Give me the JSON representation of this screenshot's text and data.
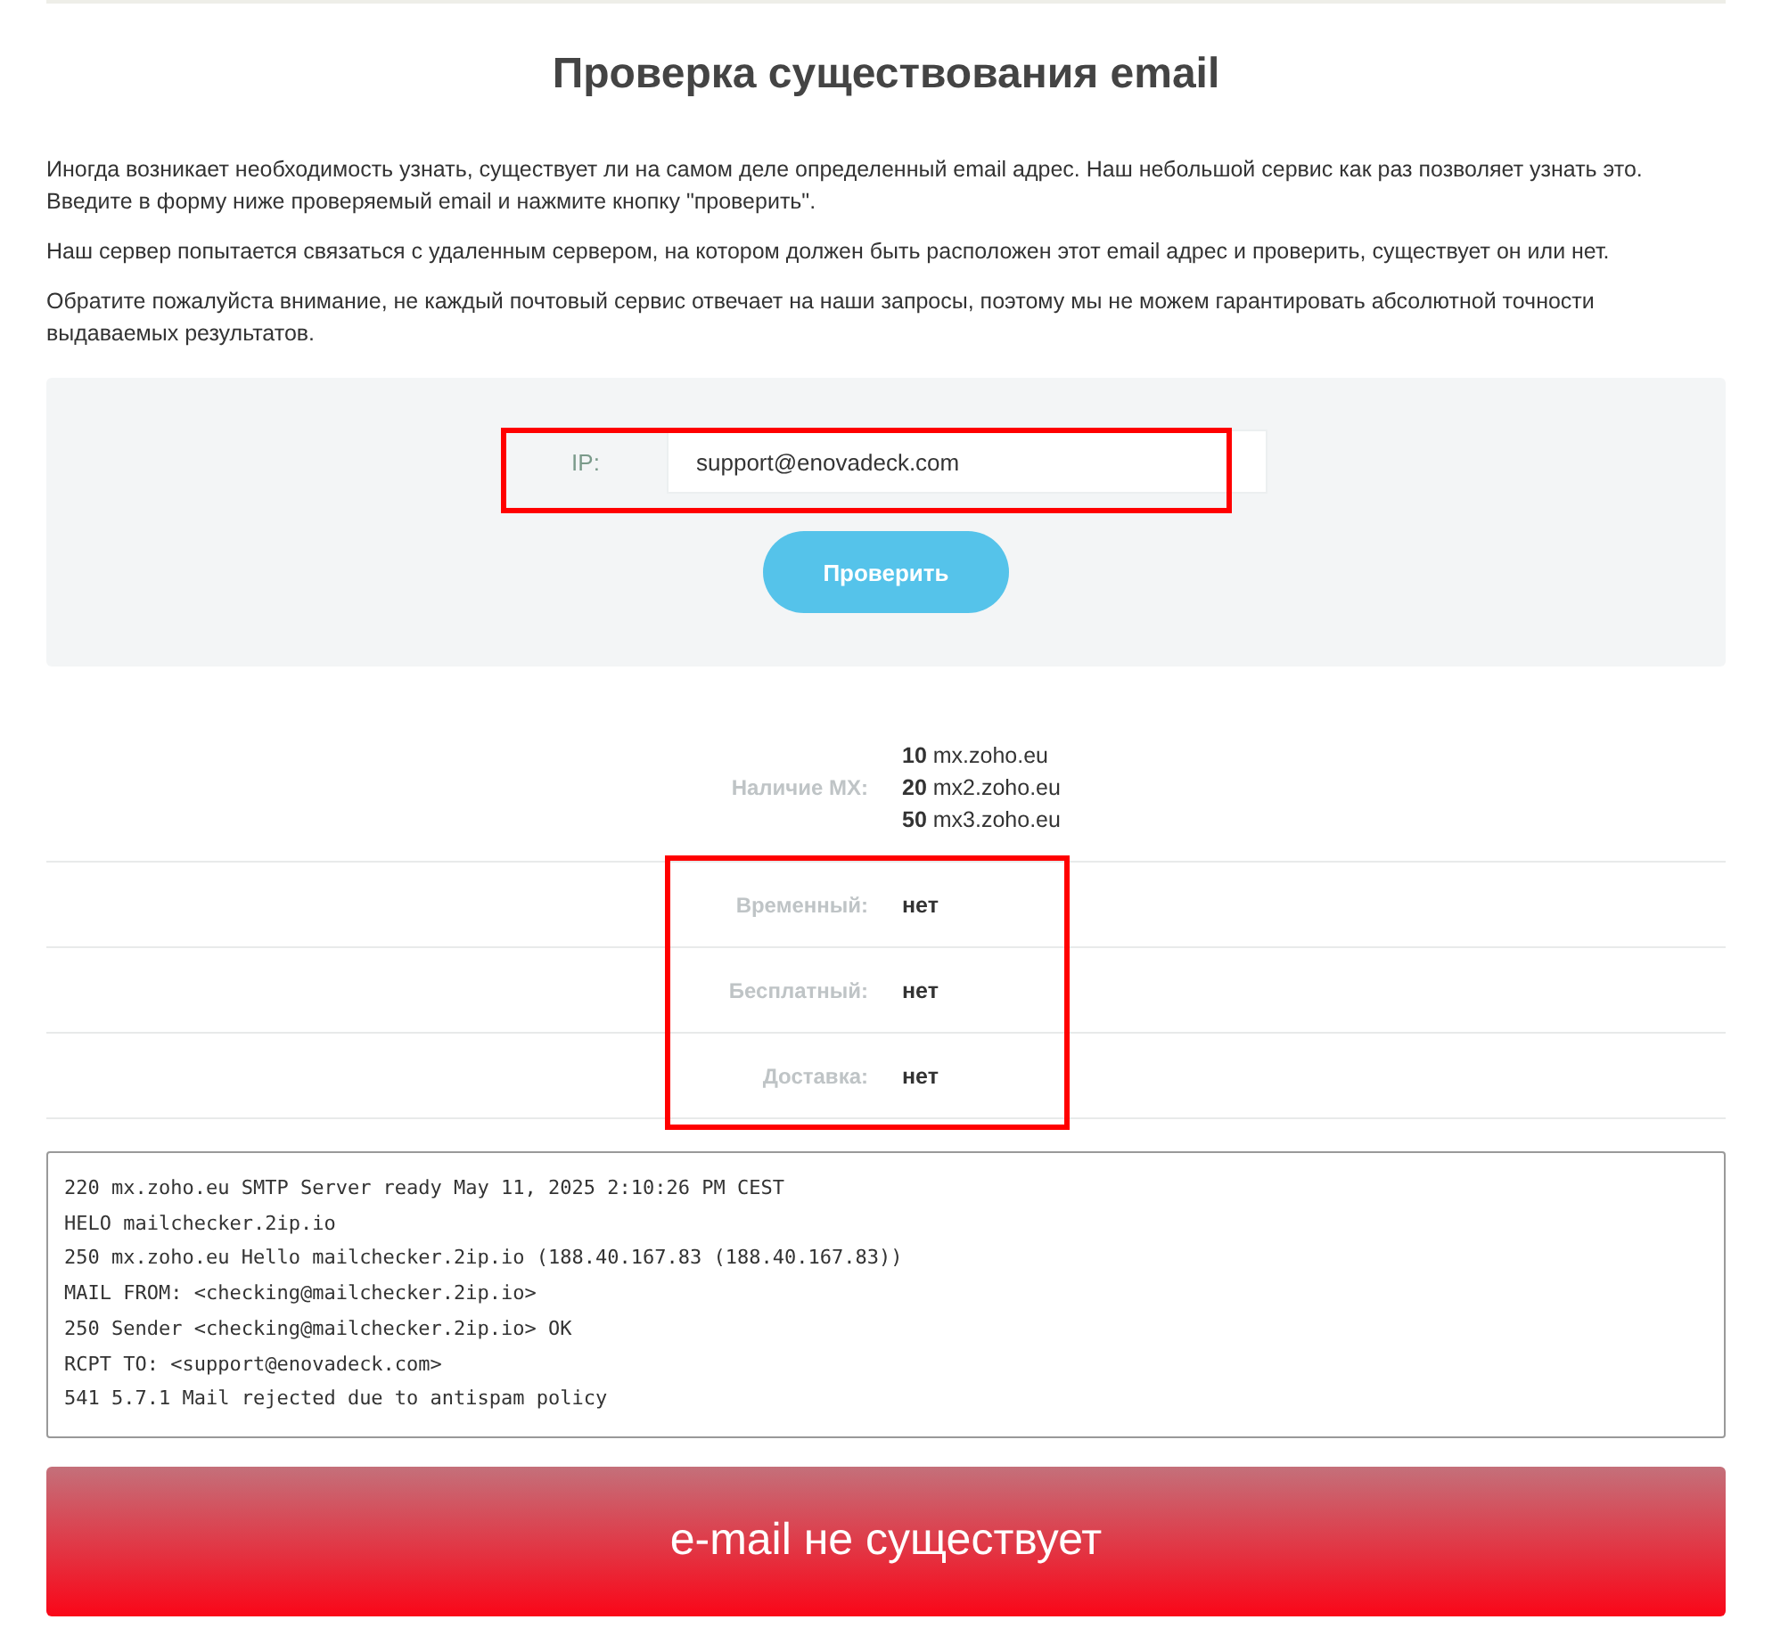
{
  "title": "Проверка существования email",
  "intro": [
    "Иногда возникает необходимость узнать, существует ли на самом деле определенный email адрес. Наш небольшой сервис как раз позволяет узнать это. Введите в форму ниже проверяемый email и нажмите кнопку \"проверить\".",
    "Наш сервер попытается связаться с удаленным сервером, на котором должен быть расположен этот email адрес и проверить, существует он или нет.",
    "Обратите пожалуйста внимание, не каждый почтовый сервис отвечает на наши запросы, поэтому мы не можем гарантировать абсолютной точности выдаваемых результатов."
  ],
  "form": {
    "label": "IP:",
    "value": "support@enovadeck.com",
    "highlighted": true,
    "button": "Проверить"
  },
  "mx": {
    "label": "Наличие MX:",
    "records": [
      "**10** mx.zoho.eu",
      "**20** mx2.zoho.eu",
      "**50** mx3.zoho.eu"
    ]
  },
  "details": {
    "highlighted": true,
    "rows": [
      {
        "label": "Временный:",
        "value": "нет"
      },
      {
        "label": "Бесплатный:",
        "value": "нет"
      },
      {
        "label": "Доставка:",
        "value": "нет"
      }
    ]
  },
  "log": [
    "220 mx.zoho.eu SMTP Server ready May 11, 2025 2:10:26 PM CEST",
    "HELO mailchecker.2ip.io",
    "250 mx.zoho.eu Hello mailchecker.2ip.io (188.40.167.83 (188.40.167.83))",
    "MAIL FROM: <checking@mailchecker.2ip.io>",
    "250 Sender <checking@mailchecker.2ip.io> OK",
    "RCPT TO: <support@enovadeck.com>",
    "541 5.7.1 Mail rejected due to antispam policy"
  ],
  "result": "e-mail не существует"
}
